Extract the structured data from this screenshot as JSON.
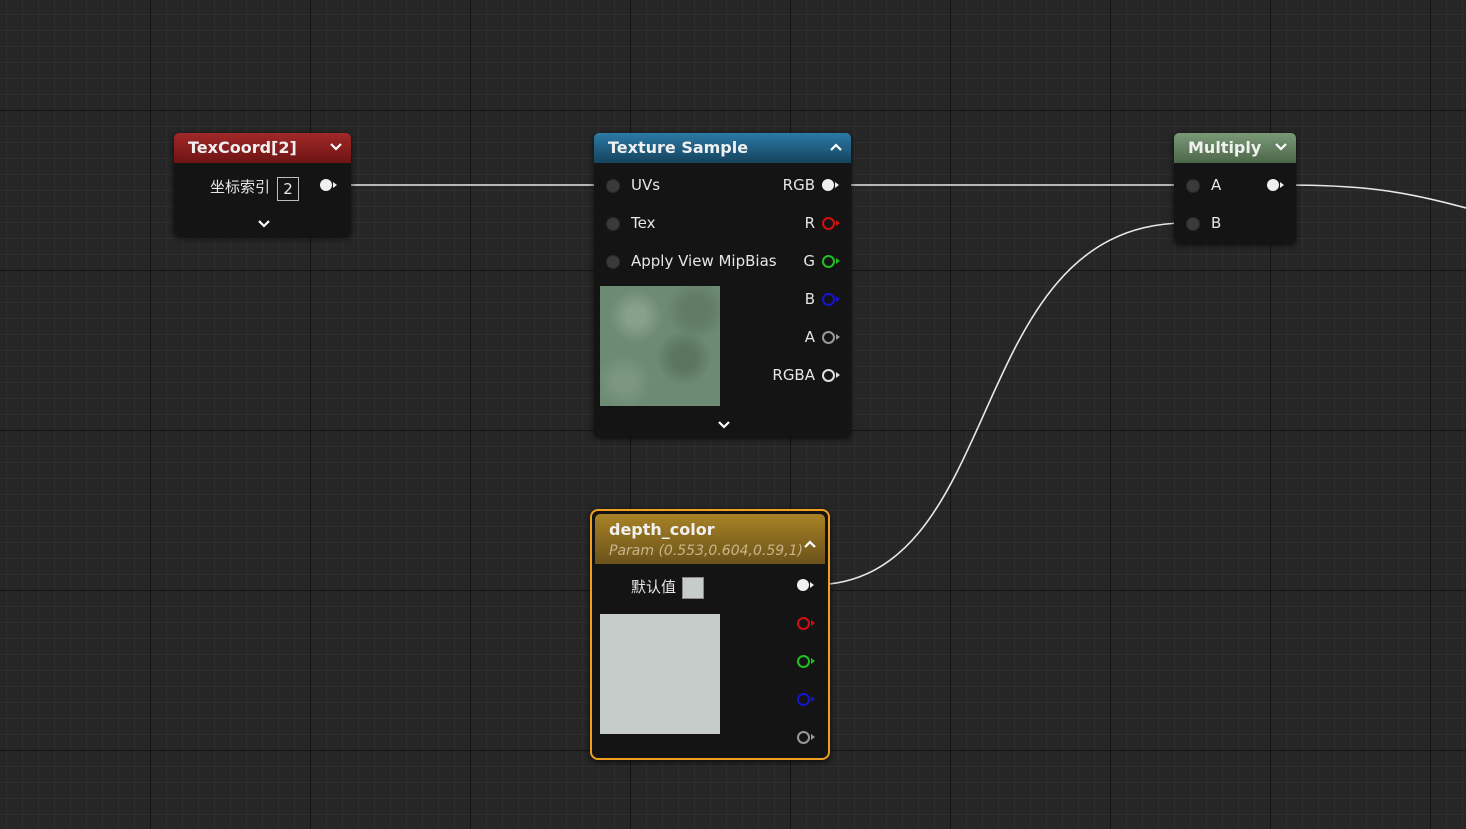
{
  "texcoord": {
    "title": "TexCoord[2]",
    "coord_label": "坐标索引",
    "coord_value": "2",
    "header_color": "#8c1c1c"
  },
  "texture_sample": {
    "title": "Texture Sample",
    "header_color": "#1f5c80",
    "inputs": [
      "UVs",
      "Tex",
      "Apply View MipBias"
    ],
    "outputs": [
      "RGB",
      "R",
      "G",
      "B",
      "A",
      "RGBA"
    ],
    "thumbnail_color": "#6d8a72"
  },
  "multiply": {
    "title": "Multiply",
    "header_color": "#5d7a5a",
    "inputs": [
      "A",
      "B"
    ]
  },
  "depth_color": {
    "title": "depth_color",
    "subtitle": "Param (0.553,0.604,0.59,1)",
    "default_label": "默认值",
    "swatch_color": "#c5ccc9",
    "header_color": "#8a6a1e",
    "selected_outline": "#f0a020"
  },
  "colors": {
    "wire": "#e8e8e8",
    "pin_red": "#d01010",
    "pin_green": "#20c020",
    "pin_blue": "#1515d0",
    "pin_gray": "#9a9a9a"
  }
}
